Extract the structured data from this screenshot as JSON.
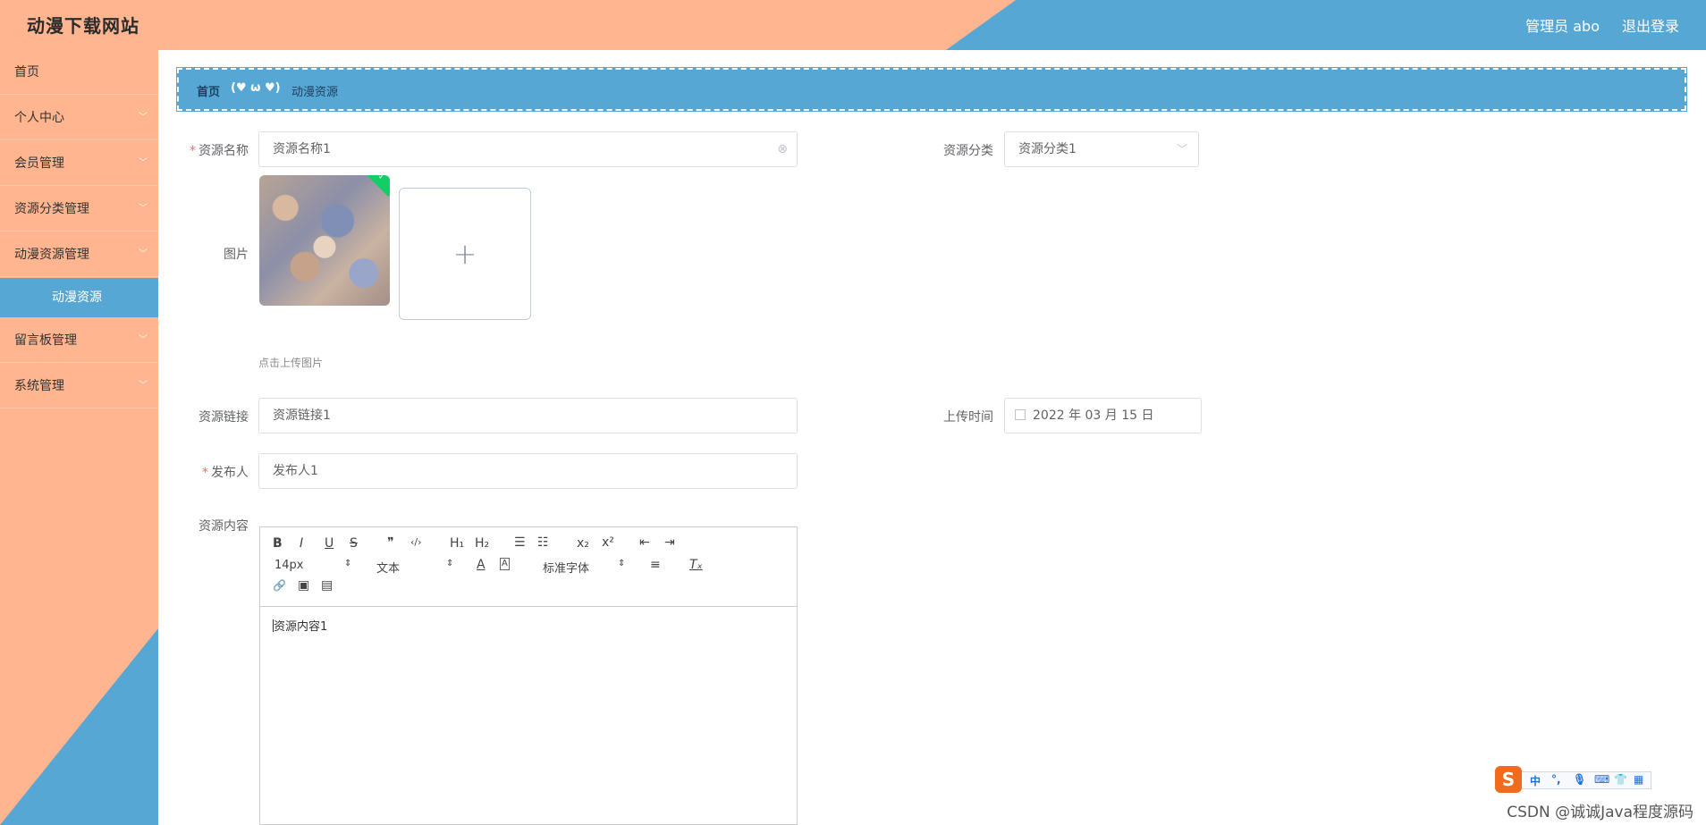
{
  "header": {
    "title": "动漫下载网站",
    "user": "管理员 abo",
    "logout": "退出登录"
  },
  "sidebar": {
    "items": [
      {
        "label": "首页"
      },
      {
        "label": "个人中心"
      },
      {
        "label": "会员管理"
      },
      {
        "label": "资源分类管理"
      },
      {
        "label": "动漫资源管理"
      },
      {
        "label": "动漫资源"
      },
      {
        "label": "留言板管理"
      },
      {
        "label": "系统管理"
      }
    ]
  },
  "breadcrumb": {
    "home": "首页",
    "separator": "(♥ ω ♥)",
    "current": "动漫资源"
  },
  "form": {
    "name": {
      "label": "资源名称",
      "value": "资源名称1"
    },
    "category": {
      "label": "资源分类",
      "value": "资源分类1"
    },
    "image": {
      "label": "图片",
      "tip": "点击上传图片",
      "plus": "+",
      "check": "✓"
    },
    "link": {
      "label": "资源链接",
      "value": "资源链接1"
    },
    "upload_time": {
      "label": "上传时间",
      "value": "2022 年 03 月 15 日"
    },
    "publisher": {
      "label": "发布人",
      "value": "发布人1"
    },
    "content": {
      "label": "资源内容",
      "value": "资源内容1"
    },
    "required_mark": "*"
  },
  "editor": {
    "font_size": "14px",
    "block_format": "文本",
    "font_family": "标准字体",
    "buttons": {
      "bold": "B",
      "italic": "I",
      "underline": "U",
      "strike": "S",
      "quote": "❞",
      "code": "‹/›",
      "h1": "H₁",
      "h2": "H₂",
      "ordered_list": "☰",
      "bullet_list": "☷",
      "sub": "x₂",
      "sup": "x²",
      "outdent": "⇤",
      "indent": "⇥",
      "color": "A",
      "background": "A",
      "align": "≡",
      "clean": "Tₓ",
      "link": "🔗",
      "image": "▣",
      "video": "▤"
    }
  },
  "ime": {
    "logo": "S",
    "lang": "中",
    "punct": "°,",
    "mic": "🎙",
    "keyboard": "⌨",
    "skin": "👕",
    "apps": "▦"
  },
  "watermark": "CSDN @诚诚Java程度源码",
  "colors": {
    "accent_blue": "#57a7d4",
    "salmon": "#ffb58f",
    "required": "#f56c6c"
  }
}
